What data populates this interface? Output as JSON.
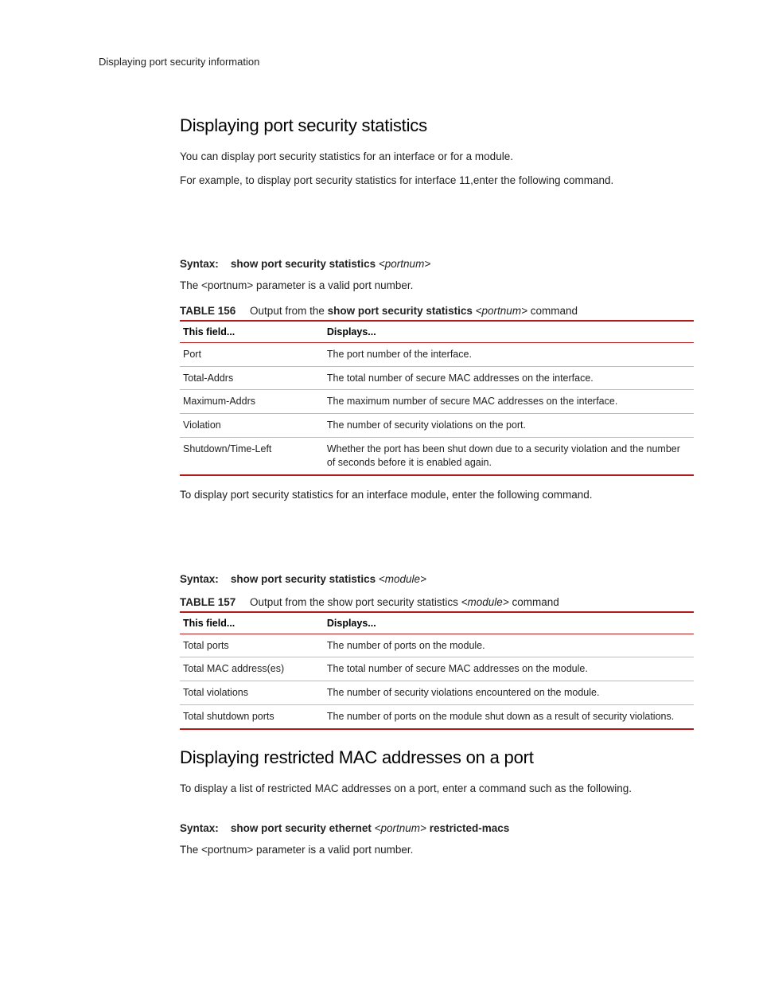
{
  "running_head": "Displaying port security information",
  "sec1": {
    "heading": "Displaying port security statistics",
    "p1": "You can display port security statistics for an interface or for a module.",
    "p2": "For example, to display port security statistics for interface 11,enter the following command.",
    "syntax1": {
      "prefix": "Syntax:",
      "cmd": "show port security statistics",
      "arg": "<portnum>"
    },
    "p_syntax_note": "The <portnum> parameter is a valid port number.",
    "table1_caption": {
      "label": "TABLE 156",
      "pre": "Output from the ",
      "bold": "show port security statistics ",
      "italic": "<portnum>",
      "post": " command"
    },
    "table1_headers": {
      "c0": "This field...",
      "c1": "Displays..."
    },
    "table1_rows": [
      {
        "c0": "Port",
        "c1": "The port number of the interface."
      },
      {
        "c0": "Total-Addrs",
        "c1": "The total number of secure MAC addresses on the interface."
      },
      {
        "c0": "Maximum-Addrs",
        "c1": "The maximum number of secure MAC addresses on the interface."
      },
      {
        "c0": "Violation",
        "c1": "The number of security violations on the port."
      },
      {
        "c0": "Shutdown/Time-Left",
        "c1": "Whether the port has been shut down due to a security violation and the number of seconds before it is enabled again."
      }
    ],
    "p3": "To display port security statistics for an interface module, enter the following command.",
    "syntax2": {
      "prefix": "Syntax:",
      "cmd": "show port security statistics",
      "arg": "<module>"
    },
    "table2_caption": {
      "label": "TABLE 157",
      "pre": "Output from the show port security statistics ",
      "italic": "<module>",
      "post": " command"
    },
    "table2_headers": {
      "c0": "This field...",
      "c1": "Displays..."
    },
    "table2_rows": [
      {
        "c0": "Total ports",
        "c1": "The number of ports on the module."
      },
      {
        "c0": "Total MAC address(es)",
        "c1": "The total number of secure MAC addresses on the module."
      },
      {
        "c0": "Total violations",
        "c1": "The number of security violations encountered on the module."
      },
      {
        "c0": "Total shutdown ports",
        "c1": "The number of ports on the module shut down as a result of security violations."
      }
    ]
  },
  "sec2": {
    "heading": "Displaying restricted MAC addresses on a port",
    "p1": "To display a list of restricted MAC addresses on a port, enter a command such as the following.",
    "syntax": {
      "prefix": "Syntax:",
      "cmd": "show port security ethernet",
      "arg": "<portnum>",
      "tail": "restricted-macs"
    },
    "p2": "The <portnum> parameter is a valid port number."
  }
}
